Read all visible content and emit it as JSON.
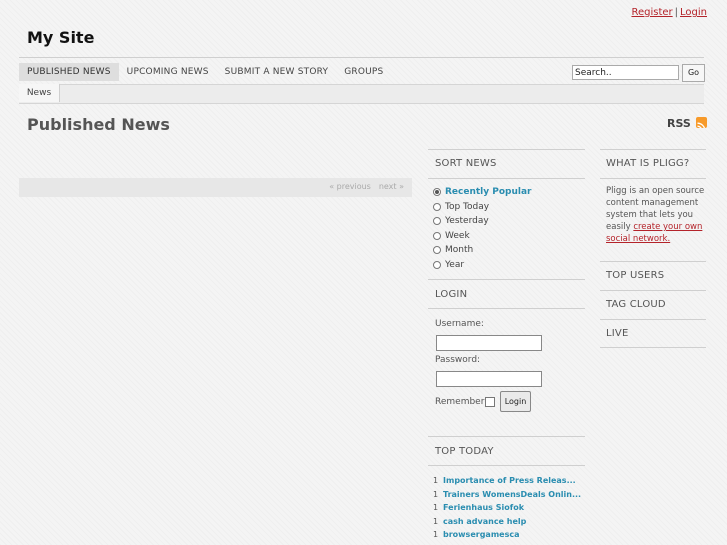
{
  "header": {
    "register_label": "Register",
    "separator": "|",
    "login_link_label": "Login",
    "site_title": "My Site"
  },
  "nav": {
    "items": [
      {
        "label": "PUBLISHED NEWS",
        "active": true
      },
      {
        "label": "UPCOMING NEWS",
        "active": false
      },
      {
        "label": "SUBMIT A NEW STORY",
        "active": false
      },
      {
        "label": "GROUPS",
        "active": false
      }
    ]
  },
  "search": {
    "value": "Search..",
    "go_label": "Go"
  },
  "subnav": {
    "tab_label": "News"
  },
  "main": {
    "title": "Published News",
    "rss_label": "RSS",
    "pager": {
      "previous": "« previous",
      "next": "next »"
    }
  },
  "sort_news": {
    "heading": "SORT NEWS",
    "options": [
      {
        "label": "Recently Popular",
        "selected": true
      },
      {
        "label": "Top Today",
        "selected": false
      },
      {
        "label": "Yesterday",
        "selected": false
      },
      {
        "label": "Week",
        "selected": false
      },
      {
        "label": "Month",
        "selected": false
      },
      {
        "label": "Year",
        "selected": false
      }
    ]
  },
  "login": {
    "heading": "LOGIN",
    "username_label": "Username:",
    "password_label": "Password:",
    "remember_label": "Remember:",
    "button_label": "Login"
  },
  "top_today": {
    "heading": "TOP TODAY",
    "items": [
      {
        "count": "1",
        "title": "Importance of Press Releas..."
      },
      {
        "count": "1",
        "title": "Trainers WomensDeals Onlin..."
      },
      {
        "count": "1",
        "title": "Ferienhaus Siofok"
      },
      {
        "count": "1",
        "title": "cash advance help"
      },
      {
        "count": "1",
        "title": "browsergamesca"
      }
    ]
  },
  "about": {
    "heading": "WHAT IS PLIGG?",
    "text": "Pligg is an open source content management system that lets you easily",
    "link": "create your own social network."
  },
  "right_sections": {
    "top_users": "TOP USERS",
    "tag_cloud": "TAG CLOUD",
    "live": "LIVE"
  },
  "colors": {
    "accent_link": "#b4232a",
    "story_link": "#2a8db0",
    "rss": "#f79a2a"
  }
}
